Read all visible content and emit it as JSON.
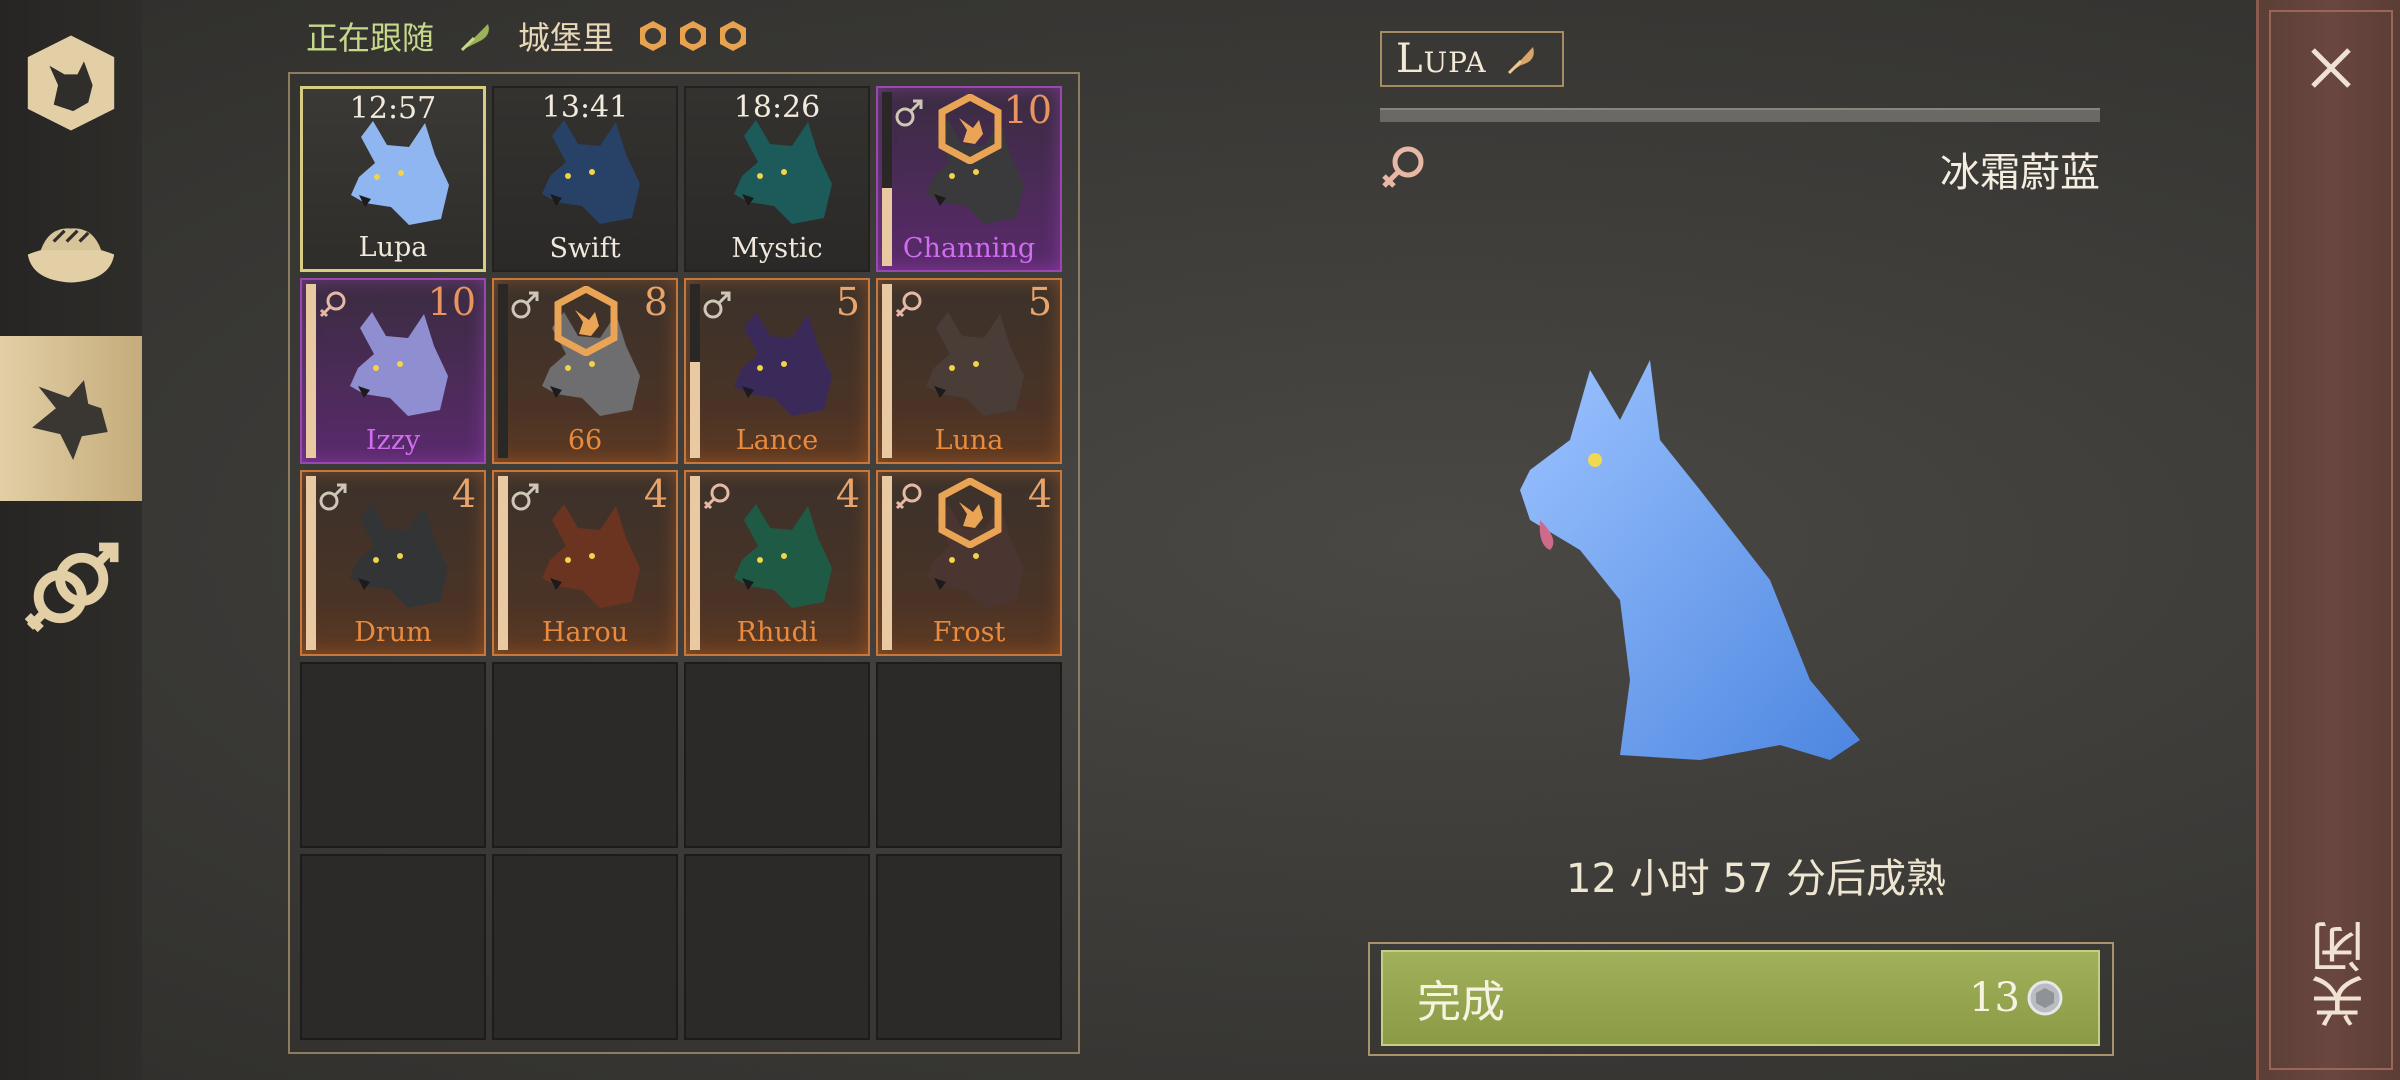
{
  "status": {
    "following_label": "正在跟随",
    "castle_label": "城堡里"
  },
  "wolves": [
    {
      "name": "Lupa",
      "time": "12:57",
      "count": "",
      "gender": "",
      "style": "selected",
      "badge": false,
      "fur": "#8fb6f0",
      "progress": 0
    },
    {
      "name": "Swift",
      "time": "13:41",
      "count": "",
      "gender": "",
      "style": "plain",
      "badge": false,
      "fur": "#274266",
      "progress": 0
    },
    {
      "name": "Mystic",
      "time": "18:26",
      "count": "",
      "gender": "",
      "style": "plain",
      "badge": false,
      "fur": "#1d5a5a",
      "progress": 0
    },
    {
      "name": "Channing",
      "time": "",
      "count": "10",
      "gender": "male",
      "style": "purple",
      "badge": true,
      "fur": "#3a3a3c",
      "progress": 0.45
    },
    {
      "name": "Izzy",
      "time": "",
      "count": "10",
      "gender": "female",
      "style": "purple",
      "badge": false,
      "fur": "#8f8ed0",
      "progress": 1.0
    },
    {
      "name": "66",
      "time": "",
      "count": "8",
      "gender": "male",
      "style": "orange",
      "badge": true,
      "fur": "#6e6e70",
      "progress": 0
    },
    {
      "name": "Lance",
      "time": "",
      "count": "5",
      "gender": "male",
      "style": "orange",
      "badge": false,
      "fur": "#3a2a5a",
      "progress": 0.55
    },
    {
      "name": "Luna",
      "time": "",
      "count": "5",
      "gender": "female",
      "style": "orange",
      "badge": false,
      "fur": "#4a3d38",
      "progress": 1.0
    },
    {
      "name": "Drum",
      "time": "",
      "count": "4",
      "gender": "male",
      "style": "orange",
      "badge": false,
      "fur": "#333436",
      "progress": 1.0
    },
    {
      "name": "Harou",
      "time": "",
      "count": "4",
      "gender": "male",
      "style": "orange",
      "badge": false,
      "fur": "#6a3420",
      "progress": 1.0
    },
    {
      "name": "Rhudi",
      "time": "",
      "count": "4",
      "gender": "female",
      "style": "orange",
      "badge": false,
      "fur": "#1f5a44",
      "progress": 1.0
    },
    {
      "name": "Frost",
      "time": "",
      "count": "4",
      "gender": "female",
      "style": "orange",
      "badge": true,
      "fur": "#4a3530",
      "progress": 1.0
    }
  ],
  "empty_slots": 8,
  "detail": {
    "name": "Lupa",
    "gender": "female",
    "breed": "冰霜蔚蓝",
    "mature_text": "12 小时 57 分后成熟",
    "finish_label": "完成",
    "finish_cost": "13"
  },
  "close_label": "关闭",
  "colors": {
    "orange_accent": "#c8773c",
    "purple_accent": "#9b47b2",
    "finish_green": "#95a44d",
    "gold": "#e8a24d"
  }
}
